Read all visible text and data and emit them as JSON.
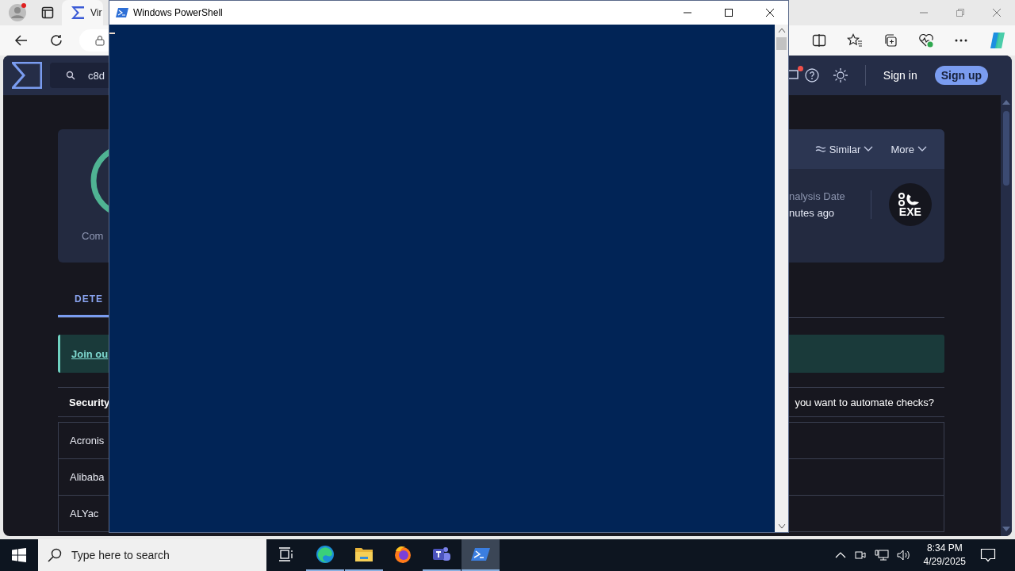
{
  "browser": {
    "tab": {
      "title": "Vir"
    }
  },
  "page": {
    "search": {
      "value": "c8d"
    },
    "header_actions": [
      {
        "kind": "link",
        "label": "Sign in"
      },
      {
        "kind": "button",
        "label": "Sign up"
      }
    ],
    "summary_card": {
      "score_label": "Com",
      "actions": [
        {
          "label": "Similar",
          "kind": "similar"
        },
        {
          "label": "More",
          "kind": "more"
        }
      ],
      "analysis_date_label": "nalysis Date",
      "analysis_date_value": "nutes ago",
      "file_type": "EXE"
    },
    "tabs": [
      {
        "label": "DETE",
        "selected": true
      }
    ],
    "banner": {
      "link": "Join ou"
    },
    "table": {
      "header_left": "Security",
      "header_right": "you want to automate checks?",
      "rows": [
        "Acronis",
        "Alibaba",
        "ALYac"
      ]
    }
  },
  "powershell": {
    "title": "Windows PowerShell"
  },
  "taskbar": {
    "search": {
      "placeholder": "Type here to search"
    },
    "apps": [
      {
        "kind": "taskview",
        "running": false,
        "selected": false
      },
      {
        "kind": "edge",
        "running": true,
        "selected": false
      },
      {
        "kind": "explorer",
        "running": true,
        "selected": false
      },
      {
        "kind": "firefox",
        "running": false,
        "selected": false
      },
      {
        "kind": "teams",
        "running": true,
        "selected": false
      },
      {
        "kind": "powershell",
        "running": true,
        "selected": true
      }
    ],
    "time": "8:34 PM",
    "date": "4/29/2025"
  }
}
